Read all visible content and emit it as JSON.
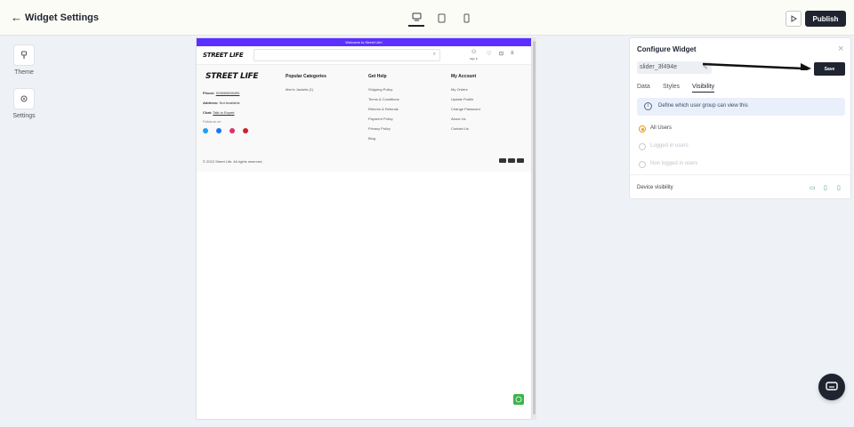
{
  "topbar": {
    "title": "Widget Settings",
    "publish_label": "Publish",
    "devices": [
      "desktop-icon",
      "tablet-icon",
      "mobile-icon"
    ]
  },
  "rail": {
    "theme_label": "Theme",
    "settings_label": "Settings"
  },
  "preview": {
    "announcement": "Welcome to Street Life!",
    "logo": "STREET LIFE",
    "sign_in_label": "Sign in",
    "footer": {
      "phone_label": "Phone:",
      "phone_value": "919869098490",
      "address_label": "Address:",
      "address_value": "Not Available",
      "chat_label": "Chat:",
      "chat_value": "Talk to Expert",
      "follow_label": "Follow us on:",
      "popular_title": "Popular Categories",
      "popular": [
        "Men's Jackets (1)"
      ],
      "help_title": "Get Help",
      "help": [
        "Shipping Policy",
        "Terms & Conditions",
        "Returns & Refunds",
        "Payment Policy",
        "Privacy Policy",
        "Blog"
      ],
      "account_title": "My Account",
      "account": [
        "My Orders",
        "Update Profile",
        "Change Password",
        "About Us",
        "Contact Us"
      ],
      "copyright": "© 2022 Street Life. All rights reserved."
    }
  },
  "panel": {
    "title": "Configure Widget",
    "widget_id": "slider_3f494e",
    "save_label": "Save",
    "tabs": [
      "Data",
      "Styles",
      "Visibility"
    ],
    "active_tab": "Visibility",
    "info_text": "Define which user group can view this",
    "options": [
      "All Users",
      "Logged in users",
      "Non logged in users"
    ],
    "selected_option": "All Users",
    "device_visibility_label": "Device visibility"
  },
  "colors": {
    "accent": "#1f2430",
    "announcement": "#5b2fff",
    "radio_selected": "#e69b22",
    "device_on": "#3aa76d"
  }
}
